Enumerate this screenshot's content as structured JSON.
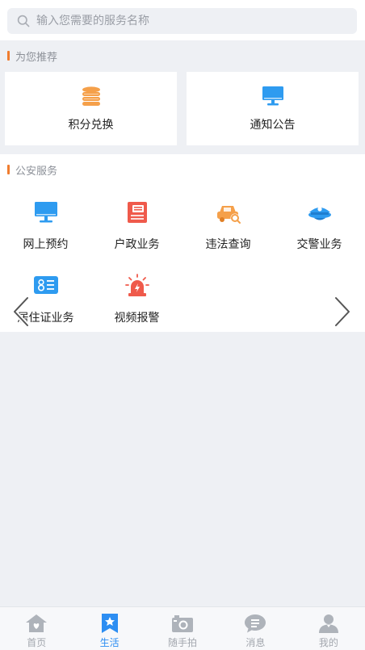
{
  "search": {
    "placeholder": "输入您需要的服务名称"
  },
  "recommend": {
    "title": "为您推荐",
    "items": [
      {
        "label": "积分兑换",
        "icon": "coins-stack-icon",
        "color": "#f5a04a"
      },
      {
        "label": "通知公告",
        "icon": "monitor-icon",
        "color": "#2e9bf0"
      }
    ]
  },
  "police": {
    "title": "公安服务",
    "items": [
      {
        "label": "网上预约",
        "icon": "monitor-icon",
        "color": "#2e9bf0"
      },
      {
        "label": "户政业务",
        "icon": "household-register-icon",
        "color": "#ef5a4b"
      },
      {
        "label": "违法查询",
        "icon": "car-search-icon",
        "color": "#f5a04a"
      },
      {
        "label": "交警业务",
        "icon": "police-cap-icon",
        "color": "#2e9bf0"
      },
      {
        "label": "居住证业务",
        "icon": "id-card-icon",
        "color": "#2e9bf0"
      },
      {
        "label": "视频报警",
        "icon": "alarm-light-icon",
        "color": "#ef5a4b"
      }
    ]
  },
  "tabbar": {
    "active_color": "#2d8ef2",
    "items": [
      {
        "label": "首页",
        "icon": "home-icon"
      },
      {
        "label": "生活",
        "icon": "bookmark-star-icon",
        "active": true
      },
      {
        "label": "随手拍",
        "icon": "camera-icon"
      },
      {
        "label": "消息",
        "icon": "chat-icon"
      },
      {
        "label": "我的",
        "icon": "user-icon"
      }
    ]
  }
}
